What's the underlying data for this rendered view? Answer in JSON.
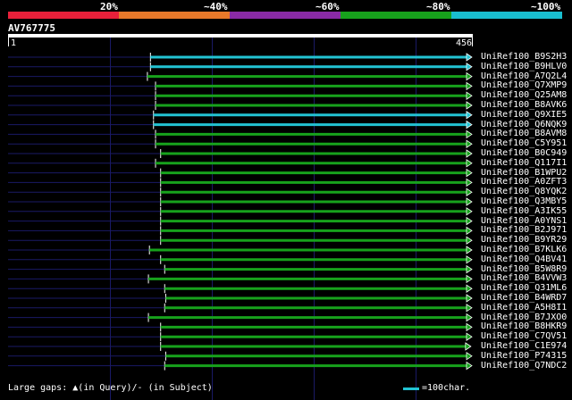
{
  "scale_labels": [
    "20%",
    "~40%",
    "~60%",
    "~80%",
    "~100%"
  ],
  "scale_colors": [
    "#e8203a",
    "#e8792a",
    "#8a2aa6",
    "#17a21c",
    "#19bfd0"
  ],
  "query": {
    "name": "AV767775",
    "start": "1",
    "end": "456",
    "length": 456
  },
  "hits": [
    {
      "name": "UniRef100_B9S2H3",
      "start": 140,
      "end": 456,
      "color": "#22c3d3"
    },
    {
      "name": "UniRef100_B9HLV0",
      "start": 140,
      "end": 456,
      "color": "#22c3d3"
    },
    {
      "name": "UniRef100_A7Q2L4",
      "start": 137,
      "end": 456,
      "color": "#17a21c"
    },
    {
      "name": "UniRef100_Q7XMP9",
      "start": 145,
      "end": 456,
      "color": "#17a21c"
    },
    {
      "name": "UniRef100_Q25AM8",
      "start": 145,
      "end": 456,
      "color": "#17a21c"
    },
    {
      "name": "UniRef100_B8AVK6",
      "start": 145,
      "end": 456,
      "color": "#17a21c"
    },
    {
      "name": "UniRef100_Q9XIE5",
      "start": 143,
      "end": 456,
      "color": "#22c3d3"
    },
    {
      "name": "UniRef100_Q6NQK9",
      "start": 143,
      "end": 456,
      "color": "#22c3d3"
    },
    {
      "name": "UniRef100_B8AVM8",
      "start": 145,
      "end": 456,
      "color": "#17a21c"
    },
    {
      "name": "UniRef100_C5Y951",
      "start": 145,
      "end": 456,
      "color": "#17a21c"
    },
    {
      "name": "UniRef100_B0C949",
      "start": 150,
      "end": 456,
      "color": "#17a21c"
    },
    {
      "name": "UniRef100_Q117I1",
      "start": 145,
      "end": 456,
      "color": "#17a21c"
    },
    {
      "name": "UniRef100_B1WPU2",
      "start": 150,
      "end": 456,
      "color": "#17a21c"
    },
    {
      "name": "UniRef100_A0ZFT3",
      "start": 150,
      "end": 456,
      "color": "#17a21c"
    },
    {
      "name": "UniRef100_Q8YQK2",
      "start": 150,
      "end": 456,
      "color": "#17a21c"
    },
    {
      "name": "UniRef100_Q3MBY5",
      "start": 150,
      "end": 456,
      "color": "#17a21c"
    },
    {
      "name": "UniRef100_A3IK55",
      "start": 150,
      "end": 456,
      "color": "#17a21c"
    },
    {
      "name": "UniRef100_A0YNS1",
      "start": 150,
      "end": 456,
      "color": "#17a21c"
    },
    {
      "name": "UniRef100_B2J971",
      "start": 150,
      "end": 456,
      "color": "#17a21c"
    },
    {
      "name": "UniRef100_B9YR29",
      "start": 150,
      "end": 456,
      "color": "#17a21c"
    },
    {
      "name": "UniRef100_B7KLK6",
      "start": 139,
      "end": 456,
      "color": "#17a21c"
    },
    {
      "name": "UniRef100_Q4BV41",
      "start": 150,
      "end": 456,
      "color": "#17a21c"
    },
    {
      "name": "UniRef100_B5W8R9",
      "start": 154,
      "end": 456,
      "color": "#17a21c"
    },
    {
      "name": "UniRef100_B4VVW3",
      "start": 138,
      "end": 456,
      "color": "#17a21c"
    },
    {
      "name": "UniRef100_Q31ML6",
      "start": 154,
      "end": 456,
      "color": "#17a21c"
    },
    {
      "name": "UniRef100_B4WRD7",
      "start": 155,
      "end": 456,
      "color": "#17a21c"
    },
    {
      "name": "UniRef100_A5H8I1",
      "start": 154,
      "end": 456,
      "color": "#17a21c"
    },
    {
      "name": "UniRef100_B7JXO0",
      "start": 138,
      "end": 456,
      "color": "#17a21c"
    },
    {
      "name": "UniRef100_B8HKR9",
      "start": 150,
      "end": 456,
      "color": "#17a21c"
    },
    {
      "name": "UniRef100_C7QV51",
      "start": 150,
      "end": 456,
      "color": "#17a21c"
    },
    {
      "name": "UniRef100_C1E974",
      "start": 150,
      "end": 455,
      "color": "#17a21c"
    },
    {
      "name": "UniRef100_P74315",
      "start": 155,
      "end": 456,
      "color": "#17a21c"
    },
    {
      "name": "UniRef100_Q7NDC2",
      "start": 154,
      "end": 456,
      "color": "#17a21c"
    }
  ],
  "legend": {
    "gaps_label": "Large gaps:",
    "gaps_query": "(in Query)/",
    "gaps_subject": "- (in Subject)",
    "scale_label": "=100char."
  }
}
